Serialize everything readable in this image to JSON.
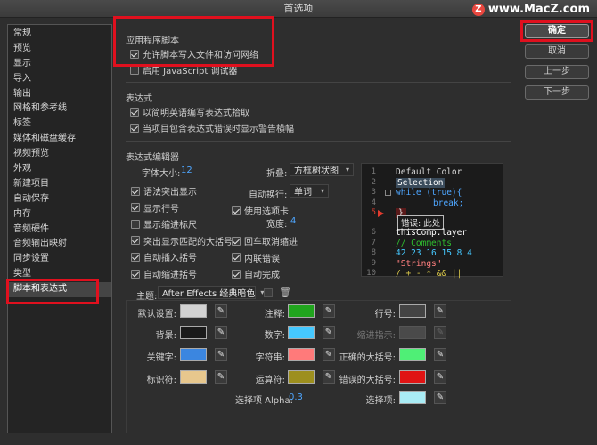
{
  "window": {
    "title": "首选项"
  },
  "watermark": {
    "icon": "Z",
    "text": "www.MacZ.com"
  },
  "sidebar": {
    "items": [
      "常规",
      "预览",
      "显示",
      "导入",
      "输出",
      "网格和参考线",
      "标签",
      "媒体和磁盘缓存",
      "视频预览",
      "外观",
      "新建项目",
      "自动保存",
      "内存",
      "音频硬件",
      "音频输出映射",
      "同步设置",
      "类型",
      "脚本和表达式"
    ],
    "selected_index": 17
  },
  "buttons": {
    "ok": "确定",
    "cancel": "取消",
    "prev": "上一步",
    "next": "下一步"
  },
  "app_scripts": {
    "title": "应用程序脚本",
    "allow_network": {
      "label": "允许脚本写入文件和访问网络",
      "checked": true
    },
    "enable_debugger": {
      "label": "启用 JavaScript 调试器",
      "checked": false
    }
  },
  "expressions": {
    "title": "表达式",
    "pick_concise": {
      "label": "以简明英语编写表达式拾取",
      "checked": true
    },
    "warn_banner": {
      "label": "当项目包含表达式错误时显示警告横幅",
      "checked": true
    }
  },
  "editor": {
    "title": "表达式编辑器",
    "font_size": {
      "label": "字体大小:",
      "value": "12"
    },
    "fold": {
      "label": "折叠:",
      "value": "方框树状图"
    },
    "wrap": {
      "label": "自动换行:",
      "value": "单词"
    },
    "use_tabs": {
      "label": "使用选项卡",
      "checked": true
    },
    "width": {
      "label": "宽度:",
      "value": "4"
    },
    "left_checks": [
      {
        "label": "语法突出显示",
        "checked": true
      },
      {
        "label": "显示行号",
        "checked": true
      },
      {
        "label": "显示缩进标尺",
        "checked": false
      },
      {
        "label": "突出显示匹配的大括号",
        "checked": true
      },
      {
        "label": "自动插入括号",
        "checked": true
      },
      {
        "label": "自动缩进括号",
        "checked": true
      }
    ],
    "mid_checks": [
      {
        "label": "回车取消缩进",
        "checked": true
      },
      {
        "label": "内联错误",
        "checked": true
      },
      {
        "label": "自动完成",
        "checked": true
      }
    ]
  },
  "code_preview": {
    "lines": [
      {
        "n": "1",
        "text": "Default Color",
        "color": "#d8d8d8"
      },
      {
        "n": "2",
        "text": "Selection",
        "color": "#ffffff"
      },
      {
        "n": "3",
        "text": "while (true){",
        "color": "#4ea6ff"
      },
      {
        "n": "4",
        "text": "break;",
        "color": "#4ea6ff"
      },
      {
        "n": "5",
        "text": "}",
        "color": "#e0e0e0"
      },
      {
        "n": "",
        "text": "错误: 此处",
        "color": "#e0e0e0"
      },
      {
        "n": "6",
        "text": "thisComp.layer",
        "color": "#ffffff"
      },
      {
        "n": "7",
        "text": "// Comments",
        "color": "#2fbf2f"
      },
      {
        "n": "8",
        "text": "42 23 16 15 8 4",
        "color": "#45c8ff"
      },
      {
        "n": "9",
        "text": "\"Strings\"",
        "color": "#ff7f7f"
      },
      {
        "n": "10",
        "text": "/ + - * && ||",
        "color": "#d8c64a"
      }
    ]
  },
  "theme": {
    "label": "主题:",
    "value": "After Effects 经典暗色",
    "colors": {
      "default": {
        "label": "默认设置:",
        "color": "#d2d2d2"
      },
      "background": {
        "label": "背景:",
        "color": "#1a1a1a"
      },
      "keyword": {
        "label": "关键字:",
        "color": "#3b86e0"
      },
      "identifier": {
        "label": "标识符:",
        "color": "#e7c78d"
      },
      "comment": {
        "label": "注释:",
        "color": "#21a51e"
      },
      "number": {
        "label": "数字:",
        "color": "#45c8ff"
      },
      "string": {
        "label": "字符串:",
        "color": "#ff7a7a"
      },
      "operator": {
        "label": "运算符:",
        "color": "#9d8f1e"
      },
      "line_number": {
        "label": "行号:",
        "color": "#444444"
      },
      "indent_guide": {
        "label": "缩进指示:",
        "color": "#4a4a4a"
      },
      "match_brace": {
        "label": "正确的大括号:",
        "color": "#4fef76"
      },
      "error_brace": {
        "label": "错误的大括号:",
        "color": "#e01414"
      },
      "selection": {
        "label": "选择项:",
        "color": "#a9ecf5"
      }
    },
    "selection_alpha": {
      "label": "选择项 Alpha:",
      "value": "0.3"
    }
  }
}
